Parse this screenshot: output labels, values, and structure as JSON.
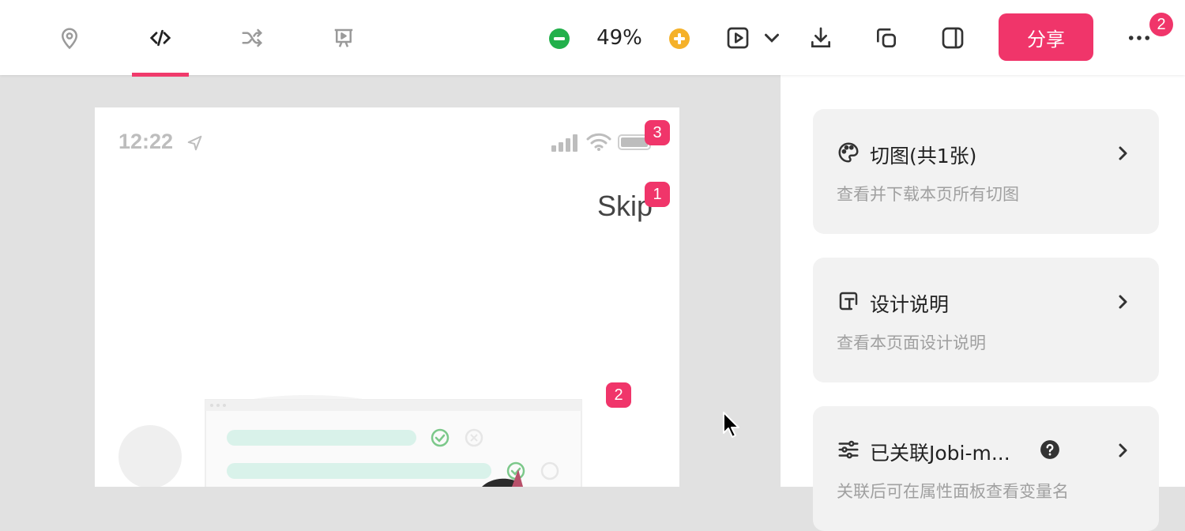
{
  "toolbar": {
    "tabs": [
      {
        "icon": "location-pin-icon"
      },
      {
        "icon": "code-icon",
        "active": true
      },
      {
        "icon": "shuffle-icon"
      },
      {
        "icon": "presentation-icon"
      }
    ],
    "zoom_value": "49%",
    "share_label": "分享",
    "more_badge": "2",
    "accent_color": "#f0356a"
  },
  "phone": {
    "time": "12:22",
    "skip_label": "Skip",
    "badges": [
      "1",
      "2",
      "3"
    ]
  },
  "panel": {
    "cards": [
      {
        "title": "切图(共1张)",
        "description": "查看并下载本页所有切图",
        "icon": "palette-icon"
      },
      {
        "title": "设计说明",
        "description": "查看本页面设计说明",
        "icon": "text-note-icon"
      },
      {
        "title": "已关联Jobi-m...",
        "description": "关联后可在属性面板查看变量名",
        "icon": "sliders-icon"
      }
    ]
  }
}
